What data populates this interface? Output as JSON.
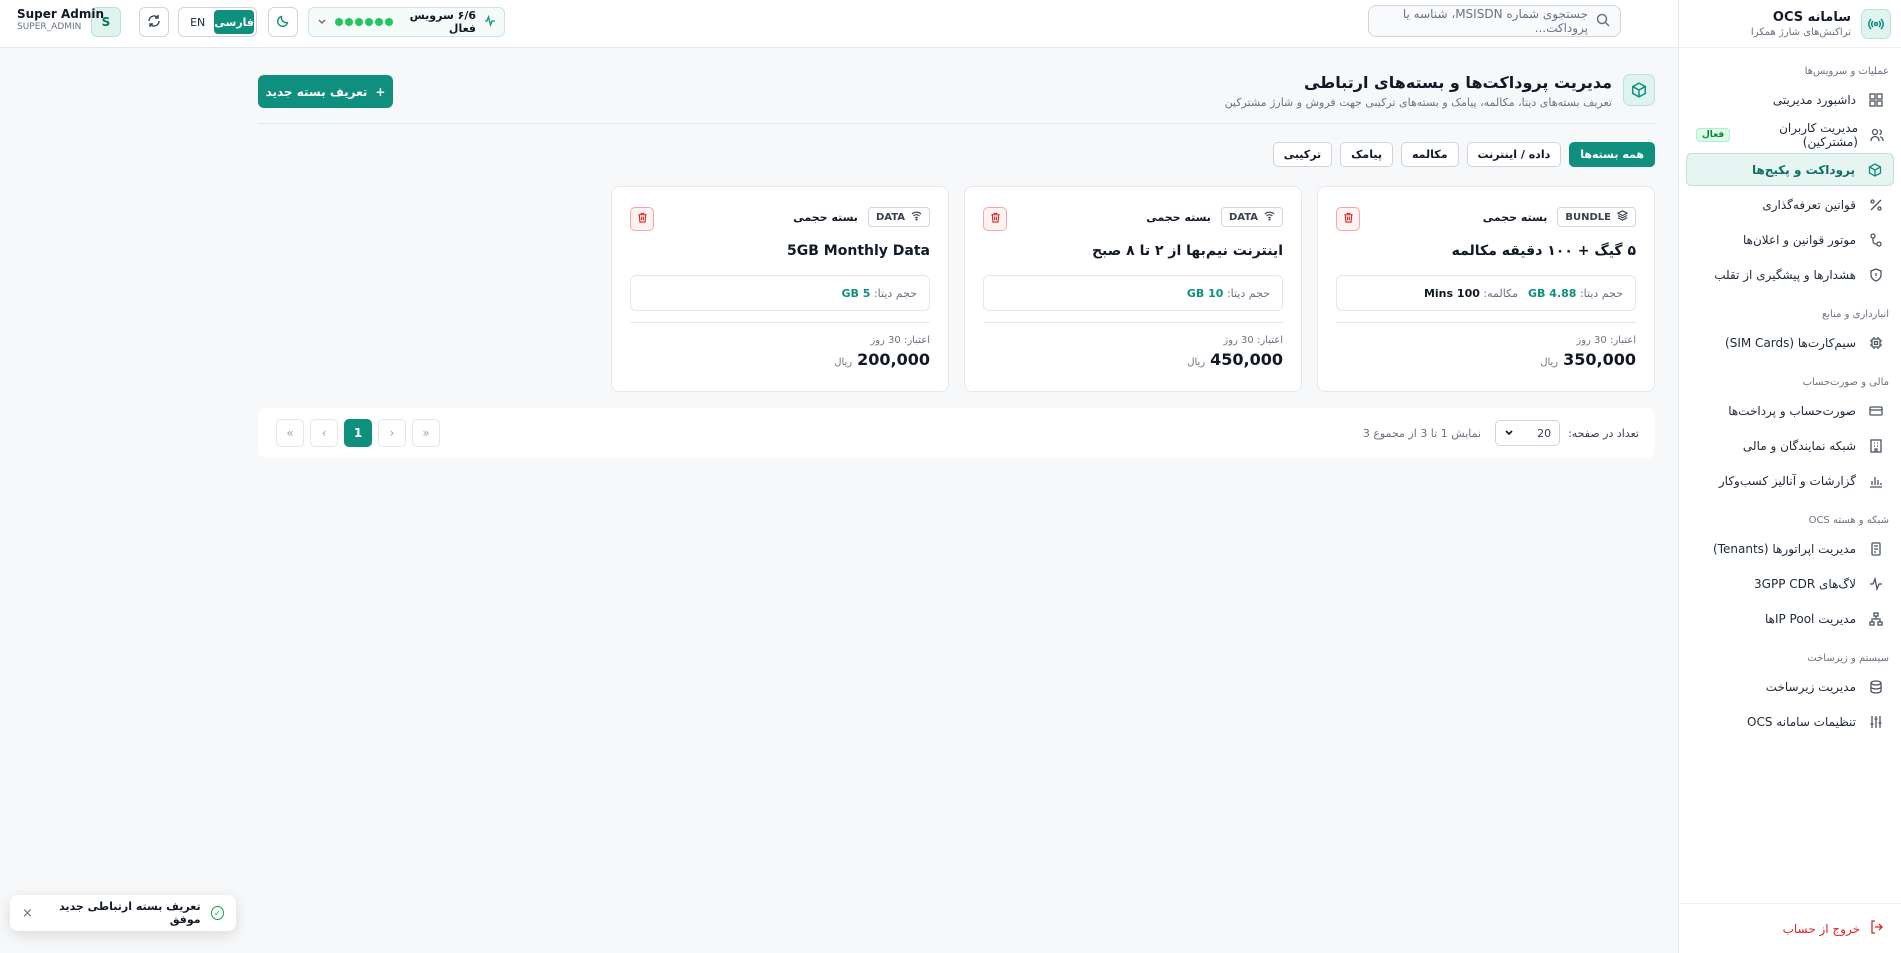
{
  "brand": {
    "title": "سامانه OCS",
    "subtitle": "تراکنش‌های شارژ همکرا"
  },
  "sidebar": {
    "sections": [
      {
        "title": "عملیات و سرویس‌ها",
        "items": [
          {
            "label": "داشبورد مدیریتی",
            "icon": "dashboard-icon"
          },
          {
            "label": "مدیریت کاربران (مشترکین)",
            "icon": "users-icon",
            "badge": "فعال"
          },
          {
            "label": "پروداکت و پکیج‌ها",
            "icon": "package-icon",
            "active": true
          },
          {
            "label": "قوانین تعرفه‌گذاری",
            "icon": "percent-icon"
          },
          {
            "label": "موتور قوانین و اعلان‌ها",
            "icon": "rules-icon"
          },
          {
            "label": "هشدارها و پیشگیری از تقلب",
            "icon": "shield-icon"
          }
        ]
      },
      {
        "title": "انبارداری و منابع",
        "items": [
          {
            "label": "سیم‌کارت‌ها (SIM Cards)",
            "icon": "chip-icon"
          }
        ]
      },
      {
        "title": "مالی و صورت‌حساب",
        "items": [
          {
            "label": "صورت‌حساب و پرداخت‌ها",
            "icon": "card-icon"
          },
          {
            "label": "شبکه نمایندگان و مالی",
            "icon": "building-icon"
          },
          {
            "label": "گزارشات و آنالیز کسب‌وکار",
            "icon": "chart-icon"
          }
        ]
      },
      {
        "title": "شبکه و هسته OCS",
        "items": [
          {
            "label": "مدیریت اپراتورها (Tenants)",
            "icon": "operator-icon"
          },
          {
            "label": "لاگ‌های 3GPP CDR",
            "icon": "activity-icon"
          },
          {
            "label": "مدیریت IP Poolها",
            "icon": "network-icon"
          }
        ]
      },
      {
        "title": "سیستم و زیرساخت",
        "items": [
          {
            "label": "مدیریت زیرساخت",
            "icon": "database-icon"
          },
          {
            "label": "تنظیمات سامانه OCS",
            "icon": "sliders-icon"
          }
        ]
      }
    ],
    "logout": "خروج از حساب"
  },
  "topbar": {
    "search_placeholder": "جستجوی شماره MSISDN، شناسه یا پروداکت...",
    "status_text": "۶/6 سرویس فعال",
    "lang_en": "EN",
    "lang_fa": "فارسی",
    "user_name": "Super Admin",
    "user_role": "SUPER_ADMIN",
    "avatar": "S"
  },
  "page": {
    "title": "مدیریت پروداکت‌ها و بسته‌های ارتباطی",
    "subtitle": "تعریف بسته‌های دیتا، مکالمه، پیامک و بسته‌های ترکیبی جهت فروش و شارژ مشترکین",
    "add_button": "تعریف بسته جدید",
    "filters": [
      "همه بسته‌ها",
      "داده / اینترنت",
      "مکالمه",
      "پیامک",
      "ترکیبی"
    ]
  },
  "cards": [
    {
      "type": "BUNDLE",
      "kind": "بسته حجمی",
      "title": "۵ گیگ + ۱۰۰ دقیقه مکالمه",
      "data_label": "حجم دیتا:",
      "data_value": "4.88 GB",
      "voice_label": "مکالمه:",
      "voice_value": "100 Mins",
      "validity": "اعتبار: 30 روز",
      "price": "350,000",
      "currency": "ریال"
    },
    {
      "type": "DATA",
      "kind": "بسته حجمی",
      "title": "اینترنت نیم‌بها از ۲ تا ۸ صبح",
      "data_label": "حجم دیتا:",
      "data_value": "10 GB",
      "validity": "اعتبار: 30 روز",
      "price": "450,000",
      "currency": "ریال"
    },
    {
      "type": "DATA",
      "kind": "بسته حجمی",
      "title": "5GB Monthly Data",
      "data_label": "حجم دیتا:",
      "data_value": "5 GB",
      "validity": "اعتبار: 30 روز",
      "price": "200,000",
      "currency": "ریال"
    }
  ],
  "pagination": {
    "per_page_label": "تعداد در صفحه:",
    "per_page_value": "20",
    "range_text": "نمایش 1 تا 3 از مجموع 3",
    "current_page": "1",
    "first": "«",
    "prev": "‹",
    "next": "›",
    "last": "»"
  },
  "toast": {
    "message": "تعریف بسته ارتباطی جدید موفق",
    "close": "×"
  }
}
